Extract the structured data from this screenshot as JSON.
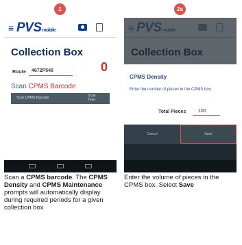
{
  "steps": [
    "1",
    "2a"
  ],
  "screen1": {
    "app_logo": "PVS",
    "app_logo_suffix": "mobile",
    "title": "Collection Box",
    "route_label": "Route",
    "route_value": "4672P545",
    "count": "0",
    "scan_prefix": "Scan ",
    "scan_highlight": "CPMS Barcode",
    "table_col1": "Scan CPMS Barcode",
    "table_col2": "Scan Time"
  },
  "screen2": {
    "app_logo": "PVS",
    "app_logo_suffix": "mobile",
    "title": "Collection Box",
    "dialog_title": "CPMS Density",
    "dialog_message": "Enter the number of pieces in the CPMS box.",
    "total_label": "Total Pieces",
    "total_value": "100",
    "cancel_label": "Cancel",
    "save_label": "Save"
  },
  "caption1": {
    "p1": "Scan a ",
    "b1": "CPMS barcode",
    "p2": ". The ",
    "b2": "CPMS Density",
    "p3": " and ",
    "b3": "CPMS Maintenance",
    "p4": " prompts will automatically display during required periods for a given collection box"
  },
  "caption2": {
    "p1": "Enter the volume of pieces in the CPMS box. Select ",
    "b1": "Save"
  },
  "colors": {
    "brand": "#0b3d91",
    "accent_red": "#c9302c",
    "badge": "#d9534f"
  }
}
